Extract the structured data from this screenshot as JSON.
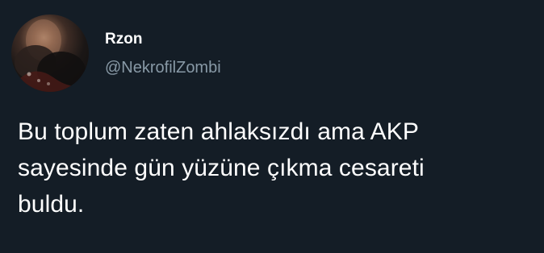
{
  "user": {
    "display_name": "Rzon",
    "handle": "@NekrofilZombi",
    "avatar_icon": "user-avatar-photo"
  },
  "tweet": {
    "text": "Bu toplum zaten ahlaksızdı ama AKP\nsayesinde gün yüzüne çıkma cesareti\nbuldu."
  },
  "colors": {
    "background": "#141d26",
    "text_primary": "#ffffff",
    "text_secondary": "#8899a6"
  }
}
